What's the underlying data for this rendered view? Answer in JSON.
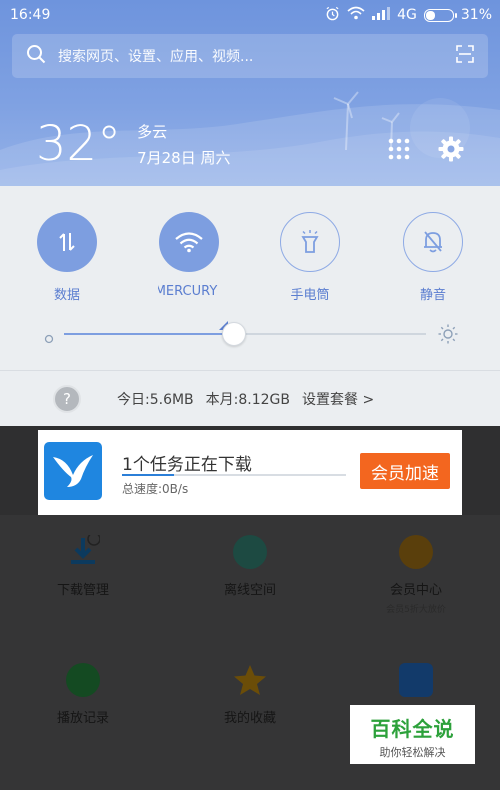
{
  "status_bar": {
    "time": "16:49",
    "network": "4G",
    "battery": "31%",
    "battery_level": 0.31
  },
  "search": {
    "placeholder": "搜索网页、设置、应用、视频..."
  },
  "weather": {
    "temperature": "32°",
    "condition": "多云",
    "date": "7月28日 周六"
  },
  "toggles": [
    {
      "label": "数据",
      "icon": "data-arrows-icon",
      "on": true
    },
    {
      "label": "MERCURY",
      "icon": "wifi-icon",
      "on": true
    },
    {
      "label": "手电筒",
      "icon": "flashlight-icon",
      "on": false
    },
    {
      "label": "静音",
      "icon": "bell-off-icon",
      "on": false
    }
  ],
  "brightness": {
    "level": 0.47
  },
  "data_usage": {
    "today": "今日:5.6MB",
    "month": "本月:8.12GB",
    "plan_link": "设置套餐 >"
  },
  "notification": {
    "title": "1个任务正在下载",
    "speed": "总速度:0B/s",
    "progress": 0.23,
    "button_label": "会员加速"
  },
  "background_app": {
    "tiles": [
      {
        "label": "下载管理",
        "sub": ""
      },
      {
        "label": "离线空间",
        "sub": ""
      },
      {
        "label": "会员中心",
        "sub": "会员5折大放价"
      },
      {
        "label": "播放记录",
        "sub": ""
      },
      {
        "label": "我的收藏",
        "sub": ""
      }
    ]
  },
  "watermark": {
    "line1": "百科全说",
    "line2": "助你轻松解决"
  },
  "colors": {
    "accent": "#7d9ee0",
    "button": "#f3661f",
    "watermark_green": "#2da13b"
  }
}
